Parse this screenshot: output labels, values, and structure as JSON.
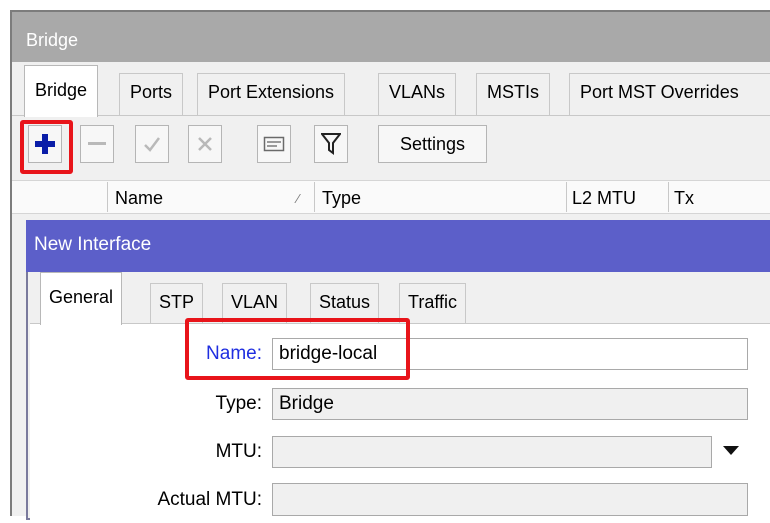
{
  "outer_window": {
    "title": "Bridge",
    "tabs": [
      "Bridge",
      "Ports",
      "Port Extensions",
      "VLANs",
      "MSTIs",
      "Port MST Overrides"
    ],
    "active_tab": "Bridge",
    "toolbar": {
      "icons": [
        "plus-icon",
        "minus-icon",
        "check-icon",
        "cross-icon",
        "comment-icon",
        "filter-icon"
      ],
      "settings_label": "Settings"
    },
    "table": {
      "columns": [
        "Name",
        "Type",
        "L2 MTU",
        "Tx"
      ],
      "sort_marker": "⁄"
    }
  },
  "dialog": {
    "title": "New Interface",
    "tabs": [
      "General",
      "STP",
      "VLAN",
      "Status",
      "Traffic"
    ],
    "active_tab": "General",
    "fields": {
      "name": {
        "label": "Name:",
        "value": "bridge-local"
      },
      "type": {
        "label": "Type:",
        "value": "Bridge"
      },
      "mtu": {
        "label": "MTU:",
        "value": ""
      },
      "actual_mtu": {
        "label": "Actual MTU:",
        "value": ""
      }
    }
  },
  "colors": {
    "highlight": "#e8141a",
    "dialog_title_bg": "#5c5fc9",
    "outer_title_bg": "#a9a9a9",
    "name_label": "#1f2ee0",
    "plus_icon": "#0a1da8"
  }
}
